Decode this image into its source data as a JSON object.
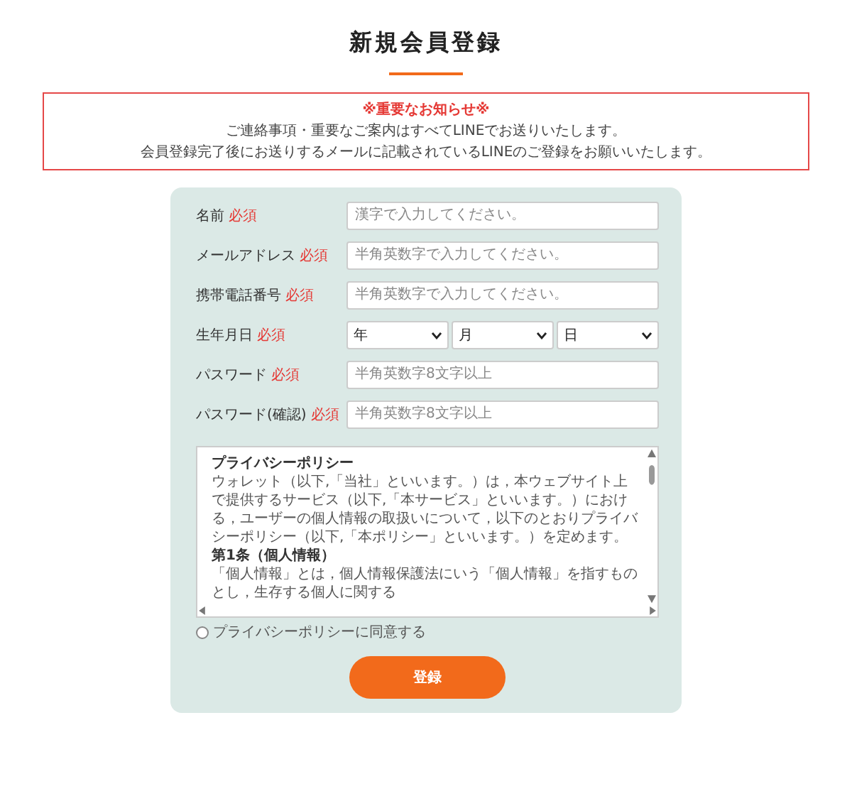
{
  "title": "新規会員登録",
  "notice": {
    "heading": "※重要なお知らせ※",
    "lines": [
      "ご連絡事項・重要なご案内はすべてLINEでお送りいたします。",
      "会員登録完了後にお送りするメールに記載されているLINEのご登録をお願いいたします。"
    ]
  },
  "fields": [
    {
      "kind": "text",
      "label": "名前",
      "required": "必須",
      "placeholder": "漢字で入力してください。"
    },
    {
      "kind": "text",
      "label": "メールアドレス",
      "required": "必須",
      "placeholder": "半角英数字で入力してください。"
    },
    {
      "kind": "text",
      "label": "携帯電話番号",
      "required": "必須",
      "placeholder": "半角英数字で入力してください。"
    },
    {
      "kind": "date",
      "label": "生年月日",
      "required": "必須",
      "selects": [
        "年",
        "月",
        "日"
      ]
    },
    {
      "kind": "text",
      "label": "パスワード",
      "required": "必須",
      "placeholder": "半角英数字8文字以上"
    },
    {
      "kind": "text",
      "label": "パスワード(確認)",
      "required": "必須",
      "placeholder": "半角英数字8文字以上"
    }
  ],
  "policy": {
    "title": "プライバシーポリシー",
    "paragraphs": [
      "ウォレット（以下,「当社」といいます。）は，本ウェブサイト上で提供するサービス（以下,「本サービス」といいます。）における，ユーザーの個人情報の取扱いについて，以下のとおりプライバシーポリシー（以下,「本ポリシー」といいます。）を定めます。"
    ],
    "section": "第1条（個人情報）",
    "section_text": "「個人情報」とは，個人情報保護法にいう「個人情報」を指すものとし，生存する個人に関する"
  },
  "agree": {
    "label": "プライバシーポリシーに同意する",
    "checked": false
  },
  "submit": "登録"
}
